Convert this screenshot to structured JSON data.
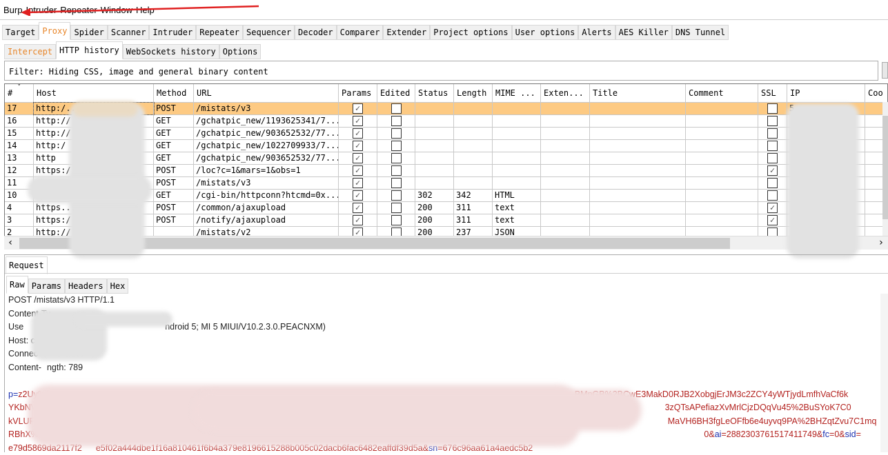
{
  "menu": {
    "items": [
      "Burp",
      "Intruder",
      "Repeater",
      "Window",
      "Help"
    ]
  },
  "main_tabs": [
    "Target",
    "Proxy",
    "Spider",
    "Scanner",
    "Intruder",
    "Repeater",
    "Sequencer",
    "Decoder",
    "Comparer",
    "Extender",
    "Project options",
    "User options",
    "Alerts",
    "AES Killer",
    "DNS Tunnel"
  ],
  "main_tab_selected": "Proxy",
  "sub_tabs": [
    "Intercept",
    "HTTP history",
    "WebSockets history",
    "Options"
  ],
  "sub_tab_selected": "HTTP history",
  "filter": "Filter: Hiding CSS, image and general binary content",
  "table": {
    "columns": [
      "#",
      "Host",
      "Method",
      "URL",
      "Params",
      "Edited",
      "Status",
      "Length",
      "MIME ...",
      "Exten...",
      "Title",
      "Comment",
      "SSL",
      "IP",
      "Coo"
    ],
    "rows": [
      {
        "n": "17",
        "host": "http:/...",
        "method": "POST",
        "url": "/mistats/v3",
        "params": true,
        "edited": false,
        "status": "",
        "length": "",
        "mime": "",
        "ssl": false,
        "ip": "5",
        "selected": true
      },
      {
        "n": "16",
        "host": "http://",
        "method": "GET",
        "url": "/gchatpic_new/1193625341/7...",
        "params": true,
        "edited": false,
        "status": "",
        "length": "",
        "mime": "",
        "ssl": false,
        "ip": ""
      },
      {
        "n": "15",
        "host": "http://",
        "method": "GET",
        "url": "/gchatpic_new/903652532/77...",
        "params": true,
        "edited": false,
        "status": "",
        "length": "",
        "mime": "",
        "ssl": false,
        "ip": ""
      },
      {
        "n": "14",
        "host": "http:/",
        "method": "GET",
        "url": "/gchatpic_new/1022709933/7...",
        "params": true,
        "edited": false,
        "status": "",
        "length": "",
        "mime": "",
        "ssl": false,
        "ip": ""
      },
      {
        "n": "13",
        "host": "http",
        "method": "GET",
        "url": "/gchatpic_new/903652532/77...",
        "params": true,
        "edited": false,
        "status": "",
        "length": "",
        "mime": "",
        "ssl": false,
        "ip": ""
      },
      {
        "n": "12",
        "host": "https:/",
        "method": "POST",
        "url": "/loc?c=1&mars=1&obs=1",
        "params": true,
        "edited": false,
        "status": "",
        "length": "",
        "mime": "",
        "ssl": true,
        "ip": ""
      },
      {
        "n": "11",
        "host": "",
        "method": "POST",
        "url": "/mistats/v3",
        "params": true,
        "edited": false,
        "status": "",
        "length": "",
        "mime": "",
        "ssl": false,
        "ip": ""
      },
      {
        "n": "10",
        "host": "",
        "method": "GET",
        "url": "/cgi-bin/httpconn?htcmd=0x...",
        "params": true,
        "edited": false,
        "status": "302",
        "length": "342",
        "mime": "HTML",
        "ssl": false,
        "ip": ""
      },
      {
        "n": "4",
        "host": "https...",
        "method": "POST",
        "url": "/common/ajaxupload",
        "params": true,
        "edited": false,
        "status": "200",
        "length": "311",
        "mime": "text",
        "ssl": true,
        "ip": ""
      },
      {
        "n": "3",
        "host": "https:/",
        "method": "POST",
        "url": "/notify/ajaxupload",
        "params": true,
        "edited": false,
        "status": "200",
        "length": "311",
        "mime": "text",
        "ssl": true,
        "ip": ""
      },
      {
        "n": "2",
        "host": "http://",
        "method": "",
        "url": "/mistats/v2",
        "params": true,
        "edited": false,
        "status": "200",
        "length": "237",
        "mime": "JSON",
        "ssl": false,
        "ip": ""
      }
    ]
  },
  "request": {
    "tab": "Request",
    "view_tabs": [
      "Raw",
      "Params",
      "Headers",
      "Hex"
    ],
    "view_selected": "Raw",
    "lines": [
      "POST /mistats/v3 HTTP/1.1",
      "Content-Ty",
      "Use",
      "ndroid 5; MI 5 MIUI/V10.2.3.0.PEACNXM)",
      "Host: c",
      "Connec",
      "t: close",
      "Content-",
      "ngth: 789"
    ],
    "params": [
      {
        "k": "p",
        "v": "z2Uy%2",
        "tail": "BMpGB%2BCwE3MakD0RJB2XobgjErJM3c2ZCY4yWTjydLmfhVaCf6k"
      },
      {
        "v": "YKbNVFcohj",
        "tail": "3zQTsAPefiazXvMrlCjzDQqVu45%2BuSYoK7C0"
      },
      {
        "v": "kVLUFD51a3xsw9n8mlfVUr4uk",
        "tail": "MaVH6BH3fgLeOFfb6e4uyvq9PA%2BHZqtZvu7C1mq"
      },
      {
        "v": "RBhX%2Fw9TEhp3y4QNA7",
        "ai": "2882303761517411749",
        "fc": "0",
        "sid_label": "sid"
      },
      {
        "v": "e79d5869da2117f2",
        "mid": "e5f02a444dbe1f16a810461f6b4a379e8196615288b005c02dacb6fac6482eaffdf39d5a",
        "sn": "676c96aa61a4aedc5b2"
      }
    ]
  },
  "colors": {
    "selected_row": "#fdca83",
    "accent": "#e8862a",
    "param_key": "#1a2fb0",
    "param_value": "#b3221f"
  }
}
